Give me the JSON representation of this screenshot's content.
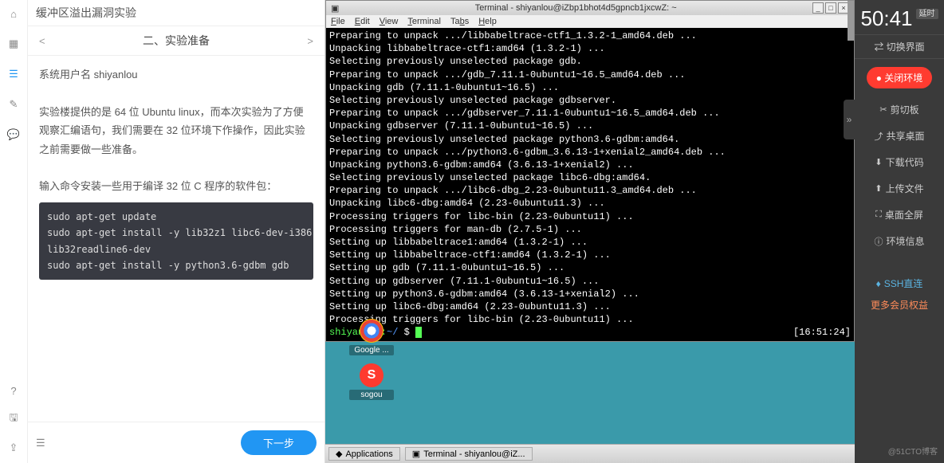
{
  "leftNav": {
    "experiment_title": "缓冲区溢出漏洞实验"
  },
  "doc": {
    "section_title": "二、实验准备",
    "p1": "系统用户名 shiyanlou",
    "p2": "实验楼提供的是 64 位 Ubuntu linux，而本次实验为了方便观察汇编语句，我们需要在 32 位环境下作操作，因此实验之前需要做一些准备。",
    "p3": "输入命令安装一些用于编译 32 位 C 程序的软件包：",
    "code": "sudo apt-get update\nsudo apt-get install -y lib32z1 libc6-dev-i386\nlib32readline6-dev\nsudo apt-get install -y python3.6-gdbm gdb",
    "next_label": "下一步"
  },
  "terminal": {
    "title": "Terminal - shiyanlou@iZbp1bhot4d5gpncb1jxcwZ: ~",
    "menus": [
      "File",
      "Edit",
      "View",
      "Terminal",
      "Tabs",
      "Help"
    ],
    "lines": [
      "Preparing to unpack .../libbabeltrace-ctf1_1.3.2-1_amd64.deb ...",
      "Unpacking libbabeltrace-ctf1:amd64 (1.3.2-1) ...",
      "Selecting previously unselected package gdb.",
      "Preparing to unpack .../gdb_7.11.1-0ubuntu1~16.5_amd64.deb ...",
      "Unpacking gdb (7.11.1-0ubuntu1~16.5) ...",
      "Selecting previously unselected package gdbserver.",
      "Preparing to unpack .../gdbserver_7.11.1-0ubuntu1~16.5_amd64.deb ...",
      "Unpacking gdbserver (7.11.1-0ubuntu1~16.5) ...",
      "Selecting previously unselected package python3.6-gdbm:amd64.",
      "Preparing to unpack .../python3.6-gdbm_3.6.13-1+xenial2_amd64.deb ...",
      "Unpacking python3.6-gdbm:amd64 (3.6.13-1+xenial2) ...",
      "Selecting previously unselected package libc6-dbg:amd64.",
      "Preparing to unpack .../libc6-dbg_2.23-0ubuntu11.3_amd64.deb ...",
      "Unpacking libc6-dbg:amd64 (2.23-0ubuntu11.3) ...",
      "Processing triggers for libc-bin (2.23-0ubuntu11) ...",
      "Processing triggers for man-db (2.7.5-1) ...",
      "Setting up libbabeltrace1:amd64 (1.3.2-1) ...",
      "Setting up libbabeltrace-ctf1:amd64 (1.3.2-1) ...",
      "Setting up gdb (7.11.1-0ubuntu1~16.5) ...",
      "Setting up gdbserver (7.11.1-0ubuntu1~16.5) ...",
      "Setting up python3.6-gdbm:amd64 (3.6.13-1+xenial2) ...",
      "Setting up libc6-dbg:amd64 (2.23-0ubuntu11.3) ...",
      "Processing triggers for libc-bin (2.23-0ubuntu11) ..."
    ],
    "prompt_user": "shiyanlou:",
    "prompt_path": "~/",
    "prompt_symbol": " $ ",
    "clock": "[16:51:24]"
  },
  "desktop": {
    "icons": [
      {
        "name": "chrome-icon",
        "label": "Google ..."
      },
      {
        "name": "sogou-icon",
        "label": "sogou",
        "glyph": "S"
      }
    ],
    "taskbar_apps": "Applications",
    "taskbar_terminal": "Terminal - shiyanlou@iZ..."
  },
  "right": {
    "timer": "50:41",
    "timer_badge": "延时",
    "switch_ui": "切换界面",
    "close_env": "关闭环境",
    "actions": [
      {
        "icon": "✂",
        "label": "剪切板"
      },
      {
        "icon": "⤴",
        "label": "共享桌面"
      },
      {
        "icon": "⬇",
        "label": "下载代码"
      },
      {
        "icon": "⬆",
        "label": "上传文件"
      },
      {
        "icon": "⛶",
        "label": "桌面全屏"
      },
      {
        "icon": "ⓘ",
        "label": "环境信息"
      }
    ],
    "ssh": "SSH直连",
    "more": "更多会员权益"
  },
  "watermark": "@51CTO博客"
}
